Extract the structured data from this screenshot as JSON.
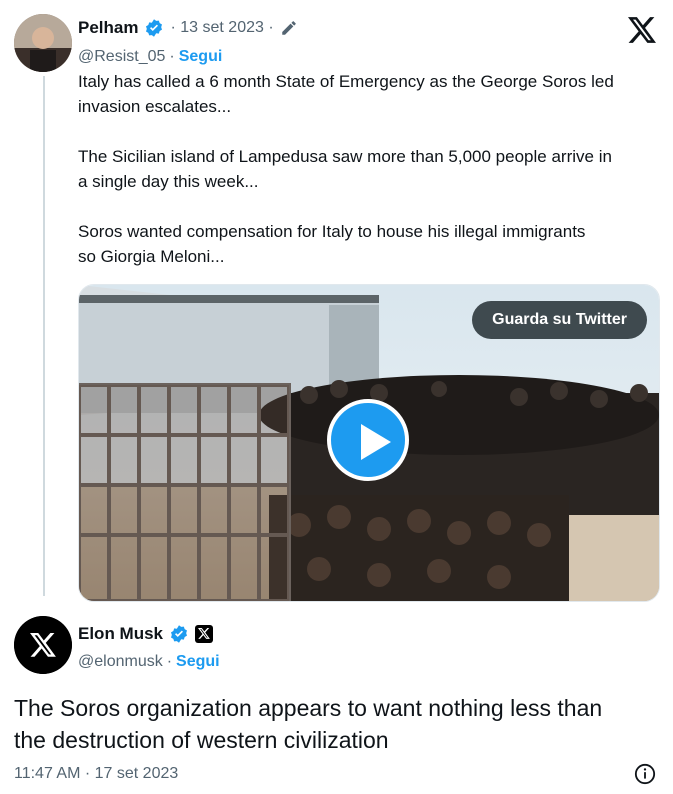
{
  "quoted": {
    "author_name": "Pelham",
    "date": "· 13 set 2023 ·",
    "handle": "@Resist_05",
    "follow_sep": "·",
    "follow_label": "Segui",
    "text": [
      "Italy has called a 6 month State of Emergency as the George Soros led",
      "invasion escalates...",
      "",
      "The Sicilian island of Lampedusa saw more than 5,000 people arrive in",
      "a single day this week...",
      "",
      "Soros wanted compensation for Italy to house his illegal immigrants",
      "so Giorgia Meloni..."
    ],
    "media": {
      "watch_label": "Guarda su Twitter"
    }
  },
  "reply": {
    "author_name": "Elon Musk",
    "handle": "@elonmusk",
    "follow_sep": "·",
    "follow_label": "Segui",
    "text_line1": "The Soros organization appears to want nothing less than",
    "text_line2": "the destruction of western civilization",
    "timestamp": "11:47 AM · 17 set 2023"
  },
  "icons": {
    "logo": "x-logo-icon",
    "verified": "verified-badge-icon",
    "edit": "pencil-edit-icon",
    "info": "info-icon",
    "play": "play-icon"
  },
  "colors": {
    "accent": "#1d9bf0",
    "muted": "#536471",
    "text": "#0f1419"
  }
}
